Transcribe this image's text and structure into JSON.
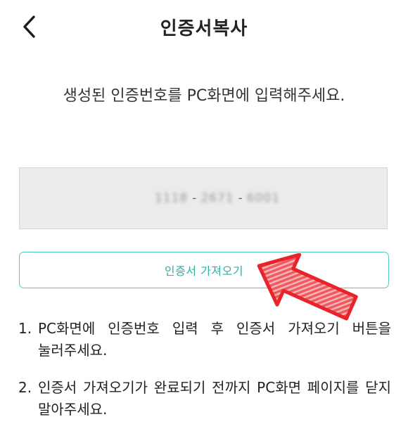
{
  "header": {
    "title": "인증서복사",
    "back_icon": "chevron-left-icon"
  },
  "instruction": "생성된 인증번호를 PC화면에 입력해주세요.",
  "code": {
    "part1": "1118",
    "sep1": "-",
    "part2": "2671",
    "sep2": "-",
    "part3": "6001",
    "blurred": true
  },
  "fetch_button": {
    "label": "인증서 가져오기"
  },
  "annotation": {
    "arrow_icon": "red-pointing-arrow",
    "color": "#e8232a"
  },
  "notes": [
    {
      "number": "1.",
      "text": "PC화면에 인증번호 입력 후 인증서 가져오기 버튼을 눌러주세요."
    },
    {
      "number": "2.",
      "text": "인증서 가져오기가 완료되기 전까지 PC화면 페이지를 닫지 말아주세요."
    }
  ],
  "colors": {
    "accent": "#2fb0a5",
    "accent_border": "#58c7bd",
    "code_bg": "#ebebeb"
  }
}
